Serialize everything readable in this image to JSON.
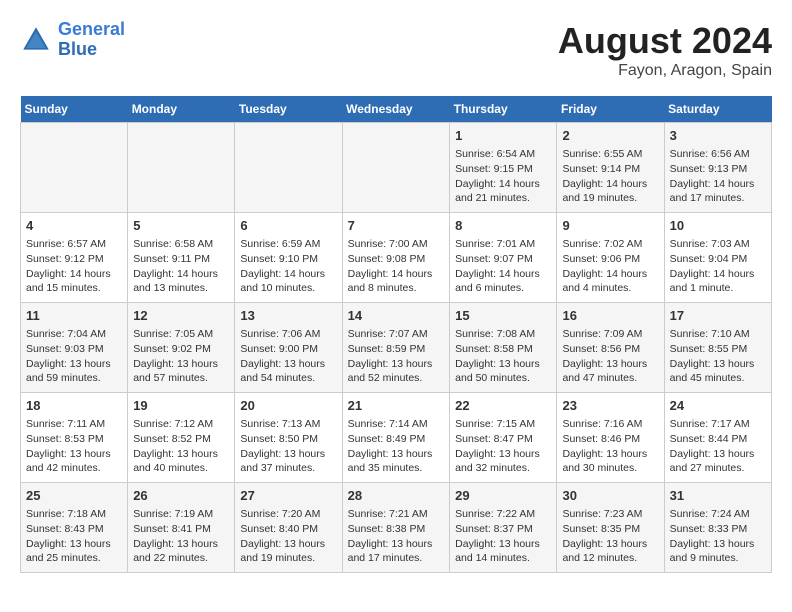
{
  "header": {
    "logo_line1": "General",
    "logo_line2": "Blue",
    "title": "August 2024",
    "subtitle": "Fayon, Aragon, Spain"
  },
  "weekdays": [
    "Sunday",
    "Monday",
    "Tuesday",
    "Wednesday",
    "Thursday",
    "Friday",
    "Saturday"
  ],
  "weeks": [
    [
      {
        "day": "",
        "info": ""
      },
      {
        "day": "",
        "info": ""
      },
      {
        "day": "",
        "info": ""
      },
      {
        "day": "",
        "info": ""
      },
      {
        "day": "1",
        "info": "Sunrise: 6:54 AM\nSunset: 9:15 PM\nDaylight: 14 hours\nand 21 minutes."
      },
      {
        "day": "2",
        "info": "Sunrise: 6:55 AM\nSunset: 9:14 PM\nDaylight: 14 hours\nand 19 minutes."
      },
      {
        "day": "3",
        "info": "Sunrise: 6:56 AM\nSunset: 9:13 PM\nDaylight: 14 hours\nand 17 minutes."
      }
    ],
    [
      {
        "day": "4",
        "info": "Sunrise: 6:57 AM\nSunset: 9:12 PM\nDaylight: 14 hours\nand 15 minutes."
      },
      {
        "day": "5",
        "info": "Sunrise: 6:58 AM\nSunset: 9:11 PM\nDaylight: 14 hours\nand 13 minutes."
      },
      {
        "day": "6",
        "info": "Sunrise: 6:59 AM\nSunset: 9:10 PM\nDaylight: 14 hours\nand 10 minutes."
      },
      {
        "day": "7",
        "info": "Sunrise: 7:00 AM\nSunset: 9:08 PM\nDaylight: 14 hours\nand 8 minutes."
      },
      {
        "day": "8",
        "info": "Sunrise: 7:01 AM\nSunset: 9:07 PM\nDaylight: 14 hours\nand 6 minutes."
      },
      {
        "day": "9",
        "info": "Sunrise: 7:02 AM\nSunset: 9:06 PM\nDaylight: 14 hours\nand 4 minutes."
      },
      {
        "day": "10",
        "info": "Sunrise: 7:03 AM\nSunset: 9:04 PM\nDaylight: 14 hours\nand 1 minute."
      }
    ],
    [
      {
        "day": "11",
        "info": "Sunrise: 7:04 AM\nSunset: 9:03 PM\nDaylight: 13 hours\nand 59 minutes."
      },
      {
        "day": "12",
        "info": "Sunrise: 7:05 AM\nSunset: 9:02 PM\nDaylight: 13 hours\nand 57 minutes."
      },
      {
        "day": "13",
        "info": "Sunrise: 7:06 AM\nSunset: 9:00 PM\nDaylight: 13 hours\nand 54 minutes."
      },
      {
        "day": "14",
        "info": "Sunrise: 7:07 AM\nSunset: 8:59 PM\nDaylight: 13 hours\nand 52 minutes."
      },
      {
        "day": "15",
        "info": "Sunrise: 7:08 AM\nSunset: 8:58 PM\nDaylight: 13 hours\nand 50 minutes."
      },
      {
        "day": "16",
        "info": "Sunrise: 7:09 AM\nSunset: 8:56 PM\nDaylight: 13 hours\nand 47 minutes."
      },
      {
        "day": "17",
        "info": "Sunrise: 7:10 AM\nSunset: 8:55 PM\nDaylight: 13 hours\nand 45 minutes."
      }
    ],
    [
      {
        "day": "18",
        "info": "Sunrise: 7:11 AM\nSunset: 8:53 PM\nDaylight: 13 hours\nand 42 minutes."
      },
      {
        "day": "19",
        "info": "Sunrise: 7:12 AM\nSunset: 8:52 PM\nDaylight: 13 hours\nand 40 minutes."
      },
      {
        "day": "20",
        "info": "Sunrise: 7:13 AM\nSunset: 8:50 PM\nDaylight: 13 hours\nand 37 minutes."
      },
      {
        "day": "21",
        "info": "Sunrise: 7:14 AM\nSunset: 8:49 PM\nDaylight: 13 hours\nand 35 minutes."
      },
      {
        "day": "22",
        "info": "Sunrise: 7:15 AM\nSunset: 8:47 PM\nDaylight: 13 hours\nand 32 minutes."
      },
      {
        "day": "23",
        "info": "Sunrise: 7:16 AM\nSunset: 8:46 PM\nDaylight: 13 hours\nand 30 minutes."
      },
      {
        "day": "24",
        "info": "Sunrise: 7:17 AM\nSunset: 8:44 PM\nDaylight: 13 hours\nand 27 minutes."
      }
    ],
    [
      {
        "day": "25",
        "info": "Sunrise: 7:18 AM\nSunset: 8:43 PM\nDaylight: 13 hours\nand 25 minutes."
      },
      {
        "day": "26",
        "info": "Sunrise: 7:19 AM\nSunset: 8:41 PM\nDaylight: 13 hours\nand 22 minutes."
      },
      {
        "day": "27",
        "info": "Sunrise: 7:20 AM\nSunset: 8:40 PM\nDaylight: 13 hours\nand 19 minutes."
      },
      {
        "day": "28",
        "info": "Sunrise: 7:21 AM\nSunset: 8:38 PM\nDaylight: 13 hours\nand 17 minutes."
      },
      {
        "day": "29",
        "info": "Sunrise: 7:22 AM\nSunset: 8:37 PM\nDaylight: 13 hours\nand 14 minutes."
      },
      {
        "day": "30",
        "info": "Sunrise: 7:23 AM\nSunset: 8:35 PM\nDaylight: 13 hours\nand 12 minutes."
      },
      {
        "day": "31",
        "info": "Sunrise: 7:24 AM\nSunset: 8:33 PM\nDaylight: 13 hours\nand 9 minutes."
      }
    ]
  ]
}
